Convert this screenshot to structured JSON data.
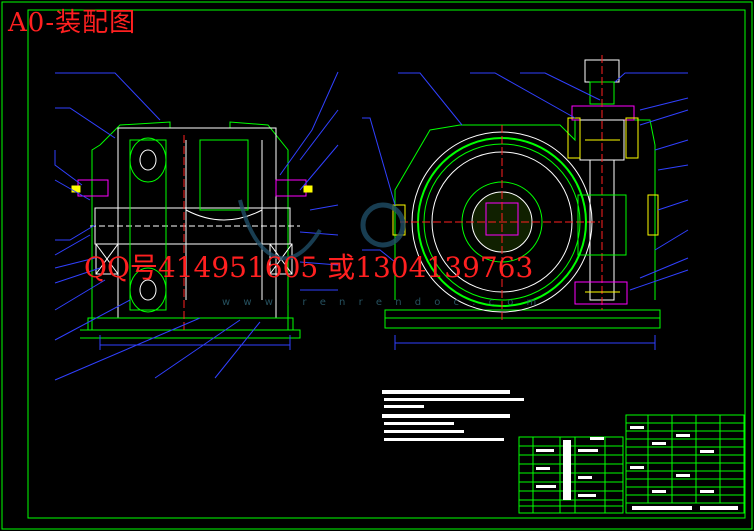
{
  "title": "A0-装配图",
  "contact": "QQ号414951605 或1304139763",
  "watermark_site": "w w w . r e n r e n d o c . c o m",
  "colors": {
    "background": "#000000",
    "border": "#00ff00",
    "outline": "#00ff00",
    "leader": "#3040ff",
    "accent": "#ffffff",
    "red_text": "#ff2020",
    "magenta": "#ff00ff",
    "yellow": "#ffff00"
  },
  "views": [
    {
      "name": "front-section-view"
    },
    {
      "name": "side-section-view"
    }
  ],
  "notes": {
    "heading": "技术要求"
  },
  "parts_list": {
    "name": "parts-list-table"
  },
  "title_block": {
    "name": "title-block"
  }
}
